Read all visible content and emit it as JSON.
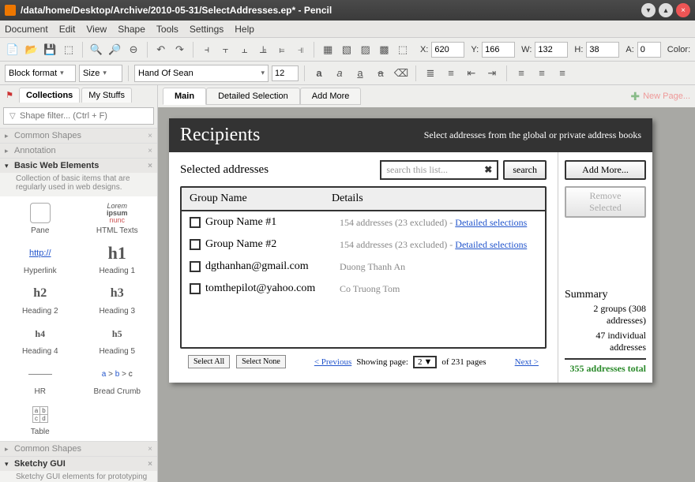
{
  "window": {
    "title": "/data/home/Desktop/Archive/2010-05-31/SelectAddresses.ep* - Pencil"
  },
  "menu": {
    "document": "Document",
    "edit": "Edit",
    "view": "View",
    "shape": "Shape",
    "tools": "Tools",
    "settings": "Settings",
    "help": "Help"
  },
  "geom": {
    "x_label": "X:",
    "x": "620",
    "y_label": "Y:",
    "y": "166",
    "w_label": "W:",
    "w": "132",
    "h_label": "H:",
    "h": "38",
    "a_label": "A:",
    "a": "0",
    "color_label": "Color:"
  },
  "fmt": {
    "block": "Block format",
    "size": "Size",
    "font": "Hand Of Sean",
    "fontsize": "12"
  },
  "left": {
    "tab_collections": "Collections",
    "tab_mystuffs": "My Stuffs",
    "filter_placeholder": "Shape filter... (Ctrl + F)",
    "cat_common": "Common Shapes",
    "cat_annotation": "Annotation",
    "cat_basic": "Basic Web Elements",
    "cat_basic_desc": "Collection of basic items that are regularly used in web designs.",
    "cat_common2": "Common Shapes",
    "cat_sketchy": "Sketchy GUI",
    "cat_sketchy_desc": "Sketchy GUI elements for prototyping",
    "shapes": {
      "pane": "Pane",
      "htmltexts_line1": "Lorem",
      "htmltexts_line2": "ipsum",
      "htmltexts_line3": "nunc",
      "htmltexts": "HTML Texts",
      "hyperlink_prev": "http://",
      "hyperlink": "Hyperlink",
      "h1_prev": "h1",
      "h1": "Heading 1",
      "h2_prev": "h2",
      "h2": "Heading 2",
      "h3_prev": "h3",
      "h3": "Heading 3",
      "h4_prev": "h4",
      "h4": "Heading 4",
      "h5_prev": "h5",
      "h5": "Heading 5",
      "hr": "HR",
      "bc_a": "a",
      "bc_b": "b",
      "bc_c": "c",
      "breadcrumb": "Bread Crumb",
      "tbl_a": "a",
      "tbl_b": "b",
      "tbl_c": "c",
      "tbl_d": "d",
      "table": "Table"
    }
  },
  "tabs": {
    "main": "Main",
    "detailed": "Detailed Selection",
    "addmore": "Add More",
    "newpage": "New Page..."
  },
  "mock": {
    "recipients": "Recipients",
    "subtitle": "Select addresses from the global or private address books",
    "selected_addresses": "Selected addresses",
    "search_ph": "search this list...",
    "search_btn": "search",
    "col_group": "Group Name",
    "col_details": "Details",
    "rows": [
      {
        "name": "Group Name #1",
        "detail_a": "154 addresses (23 excluded) - ",
        "detail_link": "Detailed selections"
      },
      {
        "name": "Group Name #2",
        "detail_a": "154 addresses (23 excluded) - ",
        "detail_link": "Detailed selections"
      },
      {
        "name": "dgthanhan@gmail.com",
        "detail_a": "Duong Thanh An",
        "detail_link": ""
      },
      {
        "name": "tomthepilot@yahoo.com",
        "detail_a": "Co Truong Tom",
        "detail_link": ""
      }
    ],
    "select_all": "Select All",
    "select_none": "Select None",
    "prev": "< Previous",
    "showing": "Showing page:",
    "page_val": "2",
    "of_pages": "of 231 pages",
    "next": "Next >",
    "add_more": "Add More...",
    "remove_sel": "Remove Selected",
    "summary": "Summary",
    "sum_groups": "2 groups (308 addresses)",
    "sum_indiv": "47 individual addresses",
    "sum_total": "355 addresses total"
  }
}
